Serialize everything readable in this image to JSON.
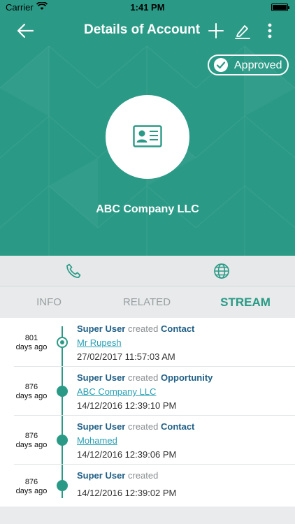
{
  "status_bar": {
    "carrier": "Carrier",
    "time": "1:41 PM"
  },
  "nav": {
    "title": "Details of Account",
    "icons": [
      "back-arrow-icon",
      "plus-icon",
      "edit-icon",
      "more-vertical-icon"
    ]
  },
  "header": {
    "status": "Approved",
    "company": "ABC Company LLC",
    "avatar_icon": "contact-card-icon"
  },
  "actions": [
    "phone-icon",
    "globe-icon"
  ],
  "tabs": [
    {
      "label": "INFO",
      "active": false
    },
    {
      "label": "RELATED",
      "active": false
    },
    {
      "label": "STREAM",
      "active": true
    }
  ],
  "stream": [
    {
      "days": "801",
      "ago": "days ago",
      "user": "Super User",
      "verb": "created",
      "type": "Contact",
      "link": "Mr Rupesh",
      "date": "27/02/2017 11:57:03 AM"
    },
    {
      "days": "876",
      "ago": "days ago",
      "user": "Super User",
      "verb": "created",
      "type": "Opportunity",
      "link": "ABC Company LLC",
      "date": "14/12/2016 12:39:10 PM"
    },
    {
      "days": "876",
      "ago": "days ago",
      "user": "Super User",
      "verb": "created",
      "type": "Contact",
      "link": "Mohamed",
      "date": "14/12/2016 12:39:06 PM"
    },
    {
      "days": "876",
      "ago": "days ago",
      "user": "Super User",
      "verb": "created",
      "type": "",
      "link": "",
      "date": "14/12/2016 12:39:02 PM"
    }
  ],
  "colors": {
    "primary": "#2a9a86",
    "link": "#2aa0b4",
    "user_text": "#1f5f86"
  }
}
